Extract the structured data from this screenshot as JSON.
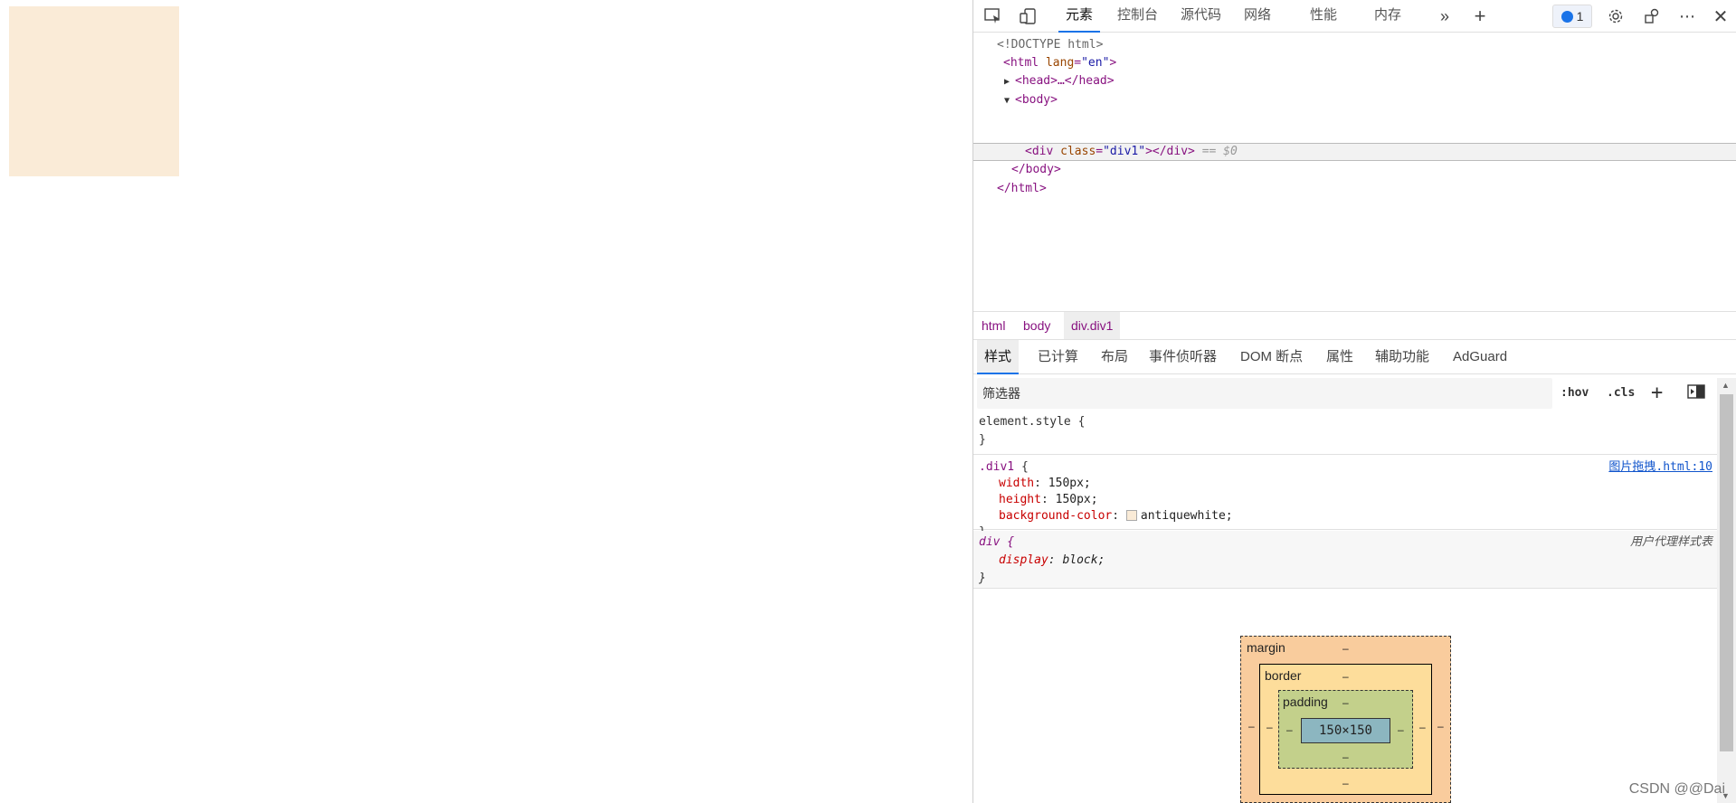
{
  "page": {
    "div_color": "#faebd7"
  },
  "toolbar": {
    "tabs": [
      "元素",
      "控制台",
      "源代码",
      "网络",
      "性能",
      "内存"
    ],
    "issues_count": "1"
  },
  "dom": {
    "doctype": "<!DOCTYPE html>",
    "html_open": "<html",
    "html_attr_name": "lang",
    "html_attr_value": "\"en\"",
    "head": "<head>…</head>",
    "body_open": "<body>",
    "div_open": "<div",
    "div_attr_name": "class",
    "div_attr_value": "\"div1\"",
    "div_close": "></div>",
    "selected_marker": "== $0",
    "body_close": "</body>",
    "html_close": "</html>"
  },
  "breadcrumb": [
    "html",
    "body",
    "div.div1"
  ],
  "subtabs": [
    "样式",
    "已计算",
    "布局",
    "事件侦听器",
    "DOM 断点",
    "属性",
    "辅助功能",
    "AdGuard"
  ],
  "filter": {
    "placeholder": "筛选器",
    "hov": ":hov",
    "cls": ".cls"
  },
  "styles": {
    "element_style_open": "element.style {",
    "close_brace": "}",
    "div1_selector": ".div1",
    "div1_open": " {",
    "div1_source": "图片拖拽.html:10",
    "div1_props": [
      {
        "name": "width",
        "value": "150px;"
      },
      {
        "name": "height",
        "value": "150px;"
      },
      {
        "name": "background-color",
        "value": "antiquewhite;"
      }
    ],
    "div_selector": "div {",
    "div_source": "用户代理样式表",
    "div_props": [
      {
        "name": "display",
        "value": "block;"
      }
    ]
  },
  "box_model": {
    "margin_label": "margin",
    "border_label": "border",
    "padding_label": "padding",
    "content_size": "150×150",
    "dash": "–"
  },
  "watermark": "CSDN @@Dai"
}
